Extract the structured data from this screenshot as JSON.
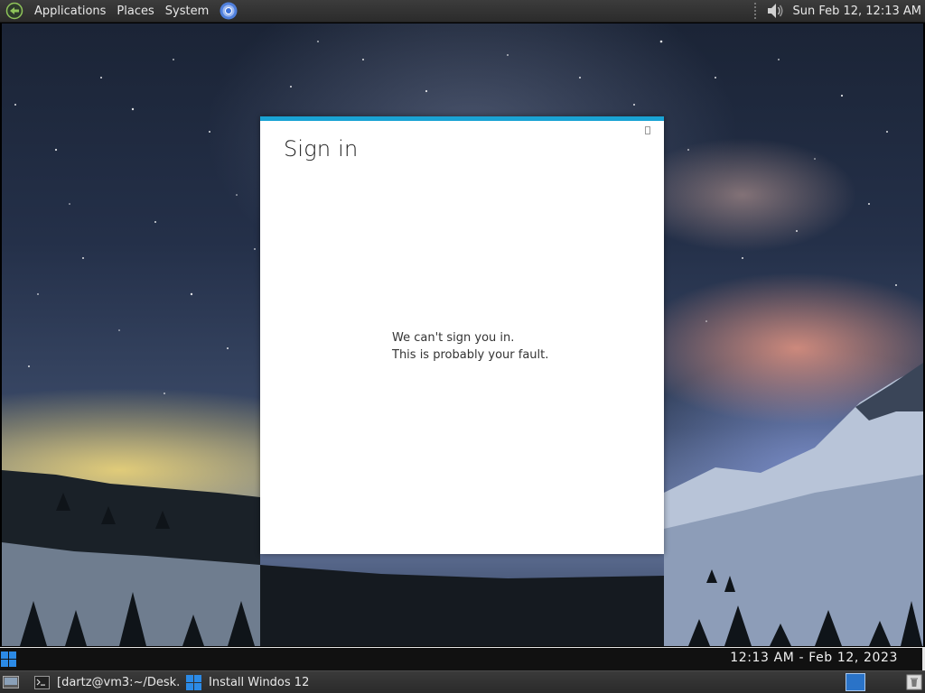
{
  "top_panel": {
    "menus": [
      "Applications",
      "Places",
      "System"
    ],
    "clock": "Sun Feb 12, 12:13 AM",
    "icons": {
      "logo": "distro-logo-icon",
      "browser": "chromium-browser-icon",
      "volume": "speaker-volume-icon"
    }
  },
  "dialog": {
    "title": "Sign in",
    "message_line1": "We can't sign you in.",
    "message_line2": "This is probably your fault.",
    "accent_color": "#1aa3d4"
  },
  "clock_bar": {
    "time": "12:13 AM - Feb 12, 2023",
    "start_icon": "windows-start-icon"
  },
  "taskbar": {
    "tasks": [
      {
        "label": "[dartz@vm3:~/Desk...",
        "icon": "terminal-icon"
      },
      {
        "label": "Install Windos 12",
        "icon": "windows-logo-icon"
      }
    ],
    "show_desktop_icon": "show-desktop-icon",
    "trash_icon": "trash-icon",
    "workspace_color": "#2a73c8"
  }
}
